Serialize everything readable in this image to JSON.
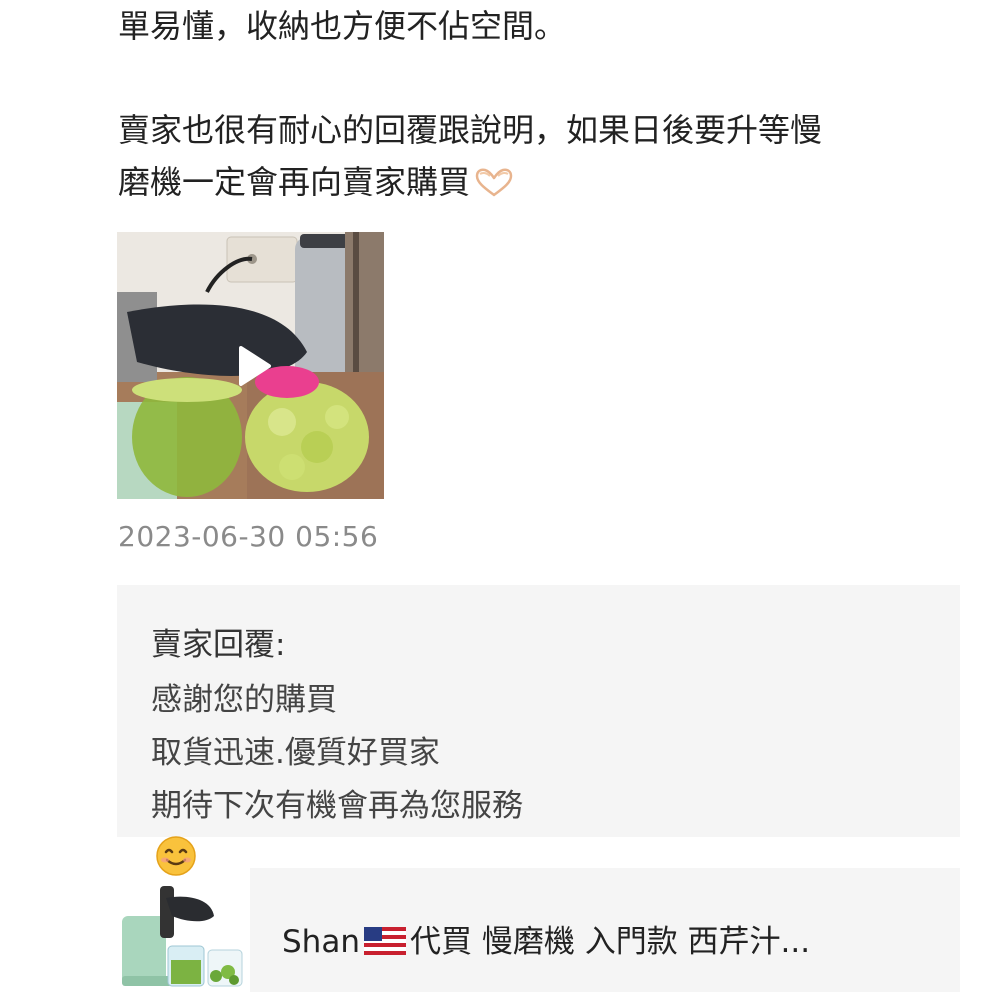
{
  "review": {
    "lines": [
      "單易懂，收納也方便不佔空間。",
      "",
      "賣家也很有耐心的回覆跟說明，如果日後要升等慢",
      "磨機一定會再向賣家購買"
    ],
    "line4_emoji": "heart-hands-icon"
  },
  "video": {
    "icon": "play-icon"
  },
  "timestamp": "2023-06-30 05:56",
  "seller_reply": {
    "title": "賣家回覆:",
    "lines": [
      "感謝您的購買",
      "取貨迅速.優質好買家",
      "期待下次有機會再為您服務"
    ],
    "emoji": "smiling-face-icon"
  },
  "product": {
    "title_prefix": "Shan",
    "flag": "us-flag-icon",
    "title_suffix": "代買 慢磨機 入門款 西芹汁..."
  },
  "colors": {
    "text": "#222222",
    "timestamp": "#8a8a8a",
    "panel_bg": "#f5f5f5"
  }
}
